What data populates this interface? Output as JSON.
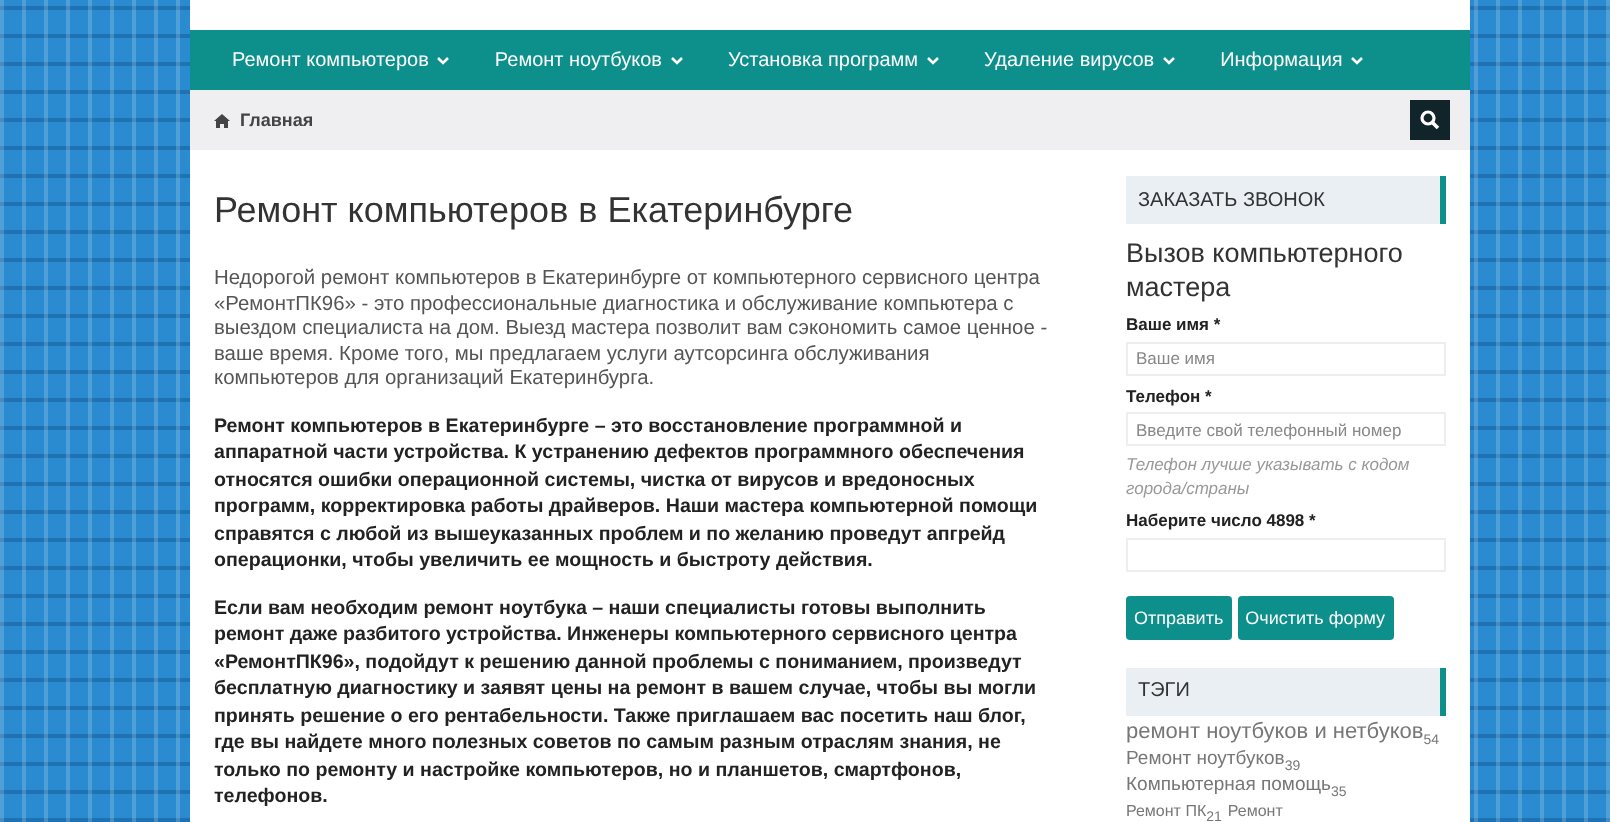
{
  "nav": {
    "items": [
      {
        "label": "Ремонт компьютеров"
      },
      {
        "label": "Ремонт ноутбуков"
      },
      {
        "label": "Установка программ"
      },
      {
        "label": "Удаление вирусов"
      },
      {
        "label": "Информация"
      }
    ]
  },
  "breadcrumb": {
    "label": "Главная"
  },
  "article": {
    "title": "Ремонт компьютеров в Екатеринбурге",
    "paragraphs": [
      {
        "kind": "plain",
        "text": "Недорогой ремонт компьютеров в Екатеринбурге от компьютерного сервисного центра «РемонтПК96» - это профессиональные диагностика и обслуживание компьютера  с выездом специалиста на дом. Выезд мастера позволит вам сэкономить самое ценное - ваше время. Кроме того, мы предлагаем услуги аутсорсинга обслуживания компьютеров для организаций Екатеринбурга."
      },
      {
        "kind": "bold",
        "text": "Ремонт компьютеров в Екатеринбурге – это восстановление программной и аппаратной части устройства. К устранению дефектов программного обеспечения относятся ошибки операционной системы, чистка от вирусов и вредоносных программ, корректировка работы драйверов. Наши мастера компьютерной помощи справятся с любой из вышеуказанных проблем и по желанию проведут апгрейд операционки, чтобы увеличить ее мощность и быстроту действия."
      },
      {
        "kind": "bold",
        "text": "Если вам необходим ремонт ноутбука – наши специалисты готовы выполнить ремонт даже разбитого устройства. Инженеры компьютерного сервисного центра  «РемонтПК96», подойдут к решению данной проблемы с пониманием, произведут бесплатную диагностику и заявят цены на ремонт в вашем случае, чтобы вы могли принять решение о его рентабельности. Также приглашаем вас посетить наш блог, где вы найдете много полезных советов по самым разным отраслям знания,  не только по ремонту и настройке компьютеров, но и планшетов, смартфонов, телефонов."
      }
    ]
  },
  "callback": {
    "header": "ЗАКАЗАТЬ ЗВОНОК",
    "title": "Вызов компьютерного мастера",
    "fields": [
      {
        "label": "Ваше имя *",
        "placeholder": "Ваше имя"
      },
      {
        "label": "Телефон *",
        "placeholder": "Введите свой телефонный номер",
        "hint": "Телефон лучше указывать с кодом города/страны"
      },
      {
        "label": "Наберите число 4898 *"
      }
    ],
    "buttons": [
      "Отправить",
      "Очистить форму"
    ]
  },
  "tags": {
    "header": "ТЭГИ",
    "items": [
      {
        "kind": "large",
        "label": "ремонт ноутбуков и нетбуков",
        "count": "54"
      },
      {
        "kind": "medium",
        "label": "Ремонт ноутбуков",
        "count": "39"
      },
      {
        "kind": "medium",
        "label": "Компьютерная помощь",
        "count": "35"
      },
      {
        "kind": "small",
        "label": "Ремонт ПК",
        "count": "21"
      },
      {
        "kind": "small",
        "label": "Ремонт"
      }
    ]
  }
}
